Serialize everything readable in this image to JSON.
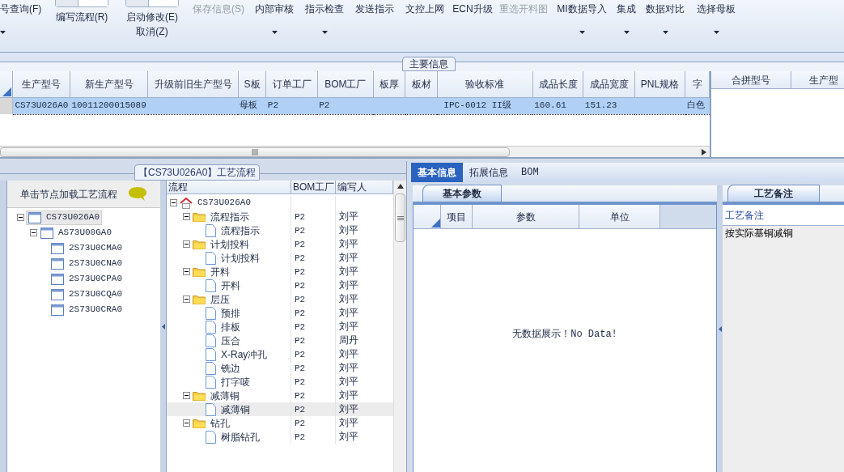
{
  "ribbon": [
    {
      "kind": "button",
      "label": "号查询(F)",
      "disabled": false,
      "menu": true
    },
    {
      "kind": "toggle",
      "label": "编写流程(R)",
      "disabled": false,
      "on": false
    },
    {
      "kind": "toggle",
      "label": "启动修改(E)",
      "sub_label": "取消(Z)",
      "disabled": false,
      "on": false
    },
    {
      "kind": "button",
      "label": "保存信息(S)",
      "disabled": true
    },
    {
      "kind": "button",
      "label": "内部审核",
      "disabled": false,
      "menu": true
    },
    {
      "kind": "button",
      "label": "指示检查",
      "disabled": false,
      "menu": true
    },
    {
      "kind": "button",
      "label": "发送指示",
      "disabled": false
    },
    {
      "kind": "button",
      "label": "文控上网",
      "disabled": false
    },
    {
      "kind": "button",
      "label": "ECN升级",
      "disabled": false
    },
    {
      "kind": "button",
      "label": "重选开料图",
      "disabled": true
    },
    {
      "kind": "button",
      "label": "MI数据导入",
      "disabled": false,
      "menu": true
    },
    {
      "kind": "button",
      "label": "集成",
      "disabled": false,
      "menu": true
    },
    {
      "kind": "button",
      "label": "数据对比",
      "disabled": false,
      "menu": true
    },
    {
      "kind": "button",
      "label": "选择母板",
      "disabled": false,
      "menu": true
    }
  ],
  "main_group": {
    "title": "主要信息",
    "table": {
      "columns": [
        "生产型号",
        "新生产型号",
        "升级前旧生产型号",
        "S板",
        "订单工厂",
        "BOM工厂",
        "板厚",
        "板材",
        "验收标准",
        "成品长度",
        "成品宽度",
        "PNL规格",
        "字"
      ],
      "rows": [
        {
          "selected": true,
          "cells": [
            "CS73U026A0",
            "10011200015089",
            "",
            "母板",
            "P2",
            "P2",
            "",
            "",
            "IPC-6012 II级",
            "160.61",
            "151.23",
            "",
            "白色"
          ]
        }
      ]
    },
    "merge_table": {
      "columns": [
        "合拼型号",
        "生产型"
      ]
    }
  },
  "flow_panel": {
    "title": "【CS73U026A0】工艺流程",
    "hint": "单击节点加载工艺流程",
    "model_tree": [
      {
        "label": "CS73U026A0",
        "selected": true,
        "expanded": true,
        "children": [
          {
            "label": "AS73U00GA0",
            "selected": false,
            "expanded": true,
            "children": [
              {
                "label": "2S73U0CMA0",
                "selected": false
              },
              {
                "label": "2S73U0CNA0",
                "selected": false
              },
              {
                "label": "2S73U0CPA0",
                "selected": false
              },
              {
                "label": "2S73U0CQA0",
                "selected": false
              },
              {
                "label": "2S73U0CRA0",
                "selected": false
              }
            ]
          }
        ]
      }
    ],
    "flow_tree": {
      "columns": [
        "流程",
        "BOM工厂",
        "编写人"
      ],
      "root": {
        "label": "CS73U026A0",
        "expanded": true,
        "children": [
          {
            "label": "流程指示",
            "bom": "P2",
            "author": "刘平",
            "expanded": true,
            "children": [
              {
                "label": "流程指示",
                "bom": "P2",
                "author": "刘平",
                "selected": false
              }
            ]
          },
          {
            "label": "计划投料",
            "bom": "P2",
            "author": "刘平",
            "expanded": true,
            "children": [
              {
                "label": "计划投料",
                "bom": "P2",
                "author": "刘平",
                "selected": false
              }
            ]
          },
          {
            "label": "开料",
            "bom": "P2",
            "author": "刘平",
            "expanded": true,
            "children": [
              {
                "label": "开料",
                "bom": "P2",
                "author": "刘平",
                "selected": false
              }
            ]
          },
          {
            "label": "层压",
            "bom": "P2",
            "author": "刘平",
            "expanded": true,
            "children": [
              {
                "label": "预排",
                "bom": "P2",
                "author": "刘平",
                "selected": false
              },
              {
                "label": "排板",
                "bom": "P2",
                "author": "刘平",
                "selected": false
              },
              {
                "label": "压合",
                "bom": "P2",
                "author": "周丹",
                "selected": false
              },
              {
                "label": "X-Ray冲孔",
                "bom": "P2",
                "author": "刘平",
                "selected": false
              },
              {
                "label": "铣边",
                "bom": "P2",
                "author": "刘平",
                "selected": false
              },
              {
                "label": "打字唛",
                "bom": "P2",
                "author": "刘平",
                "selected": false
              }
            ]
          },
          {
            "label": "减薄铜",
            "bom": "P2",
            "author": "刘平",
            "expanded": true,
            "children": [
              {
                "label": "减薄铜",
                "bom": "P2",
                "author": "刘平",
                "selected": true
              }
            ]
          },
          {
            "label": "钻孔",
            "bom": "P2",
            "author": "刘平",
            "expanded": true,
            "children": [
              {
                "label": "树脂钻孔",
                "bom": "P2",
                "author": "刘平",
                "selected": false
              }
            ]
          }
        ]
      }
    }
  },
  "detail_tabs": [
    {
      "label": "基本信息",
      "selected": true
    },
    {
      "label": "拓展信息",
      "selected": false
    },
    {
      "label": "BOM",
      "selected": false
    }
  ],
  "basic_params": {
    "tab": "基本参数",
    "columns": [
      "项目",
      "参数",
      "单位"
    ],
    "empty_message": "无数据展示！No Data!"
  },
  "process_notes": {
    "tab": "工艺备注",
    "column": "工艺备注",
    "text": "按实际基铜减铜"
  }
}
